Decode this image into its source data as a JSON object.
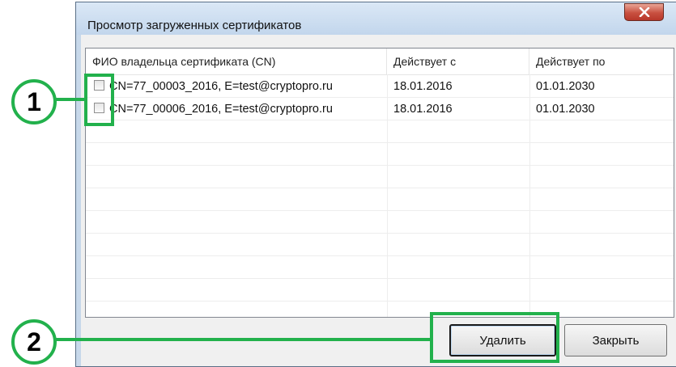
{
  "dialog": {
    "title": "Просмотр загруженных сертификатов",
    "close_icon": "close-icon"
  },
  "list": {
    "columns": [
      "ФИО владельца сертификата (CN)",
      "Действует с",
      "Действует по"
    ],
    "rows": [
      {
        "checked": false,
        "cn": "CN=77_00003_2016, E=test@cryptopro.ru",
        "from": "18.01.2016",
        "to": "01.01.2030"
      },
      {
        "checked": false,
        "cn": "CN=77_00006_2016, E=test@cryptopro.ru",
        "from": "18.01.2016",
        "to": "01.01.2030"
      }
    ]
  },
  "buttons": {
    "delete": "Удалить",
    "close": "Закрыть"
  },
  "annotations": {
    "marker1": "1",
    "marker2": "2",
    "color": "#22b14c"
  }
}
